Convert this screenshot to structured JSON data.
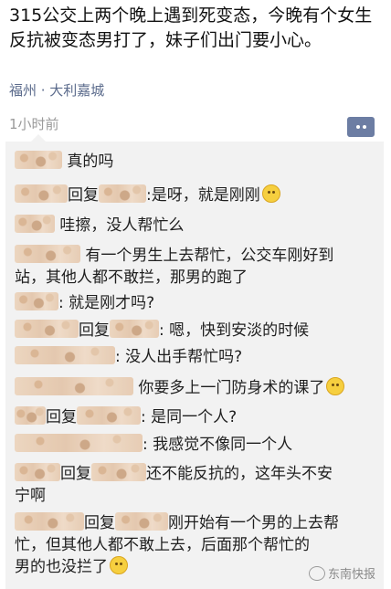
{
  "post": {
    "text": "315公交上两个晚上遇到死变态，今晚有个女生反抗被变态男打了，妹子们出门要小心。",
    "location": "福州 · 大利嘉城",
    "time": "1小时前"
  },
  "comments": [
    {
      "t1": "真的吗"
    },
    {
      "t1": "回复",
      "t2": ":是呀，就是刚刚"
    },
    {
      "t1": "哇擦，没人帮忙么"
    },
    {
      "t1": "有一个男生上去帮忙，公交车刚好到"
    },
    {
      "t1": "站，其他人都不敢拦，那男的跑了"
    },
    {
      "t1": ": 就是刚才吗?"
    },
    {
      "t1": "回复",
      "t2": ": 嗯，快到安淡的时候"
    },
    {
      "t1": ": 没人出手帮忙吗?"
    },
    {
      "t1": "你要多上一门防身术的课了"
    },
    {
      "t1": "回复",
      "t2": ": 是同一个人?"
    },
    {
      "t1": ": 我感觉不像同一个人"
    },
    {
      "t1": "回复",
      "t2": "还不能反抗的，这年头不安"
    },
    {
      "t1": "宁啊"
    },
    {
      "t1": "回复",
      "t2": "刚开始有一个男的上去帮"
    },
    {
      "t1": "忙，但其他人都不敢上去，后面那个帮忙的"
    },
    {
      "t1": "男的也没拦了"
    }
  ],
  "watermark": "东南快报"
}
